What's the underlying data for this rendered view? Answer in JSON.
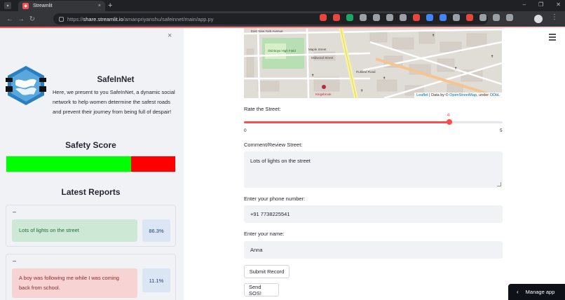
{
  "browser": {
    "tab_title": "Streamlit",
    "new_tab": "+",
    "tab_close": "×",
    "url_host": "share.streamlit.io",
    "url_path": "/amanpriyanshu/safeinnet/main/app.py",
    "url_scheme": "https://",
    "back": "←",
    "forward": "→",
    "reload": "↻",
    "window_controls": [
      "–",
      "❐",
      "✕"
    ],
    "menu_icon": "⋮",
    "extension_colors": [
      "#e8453c",
      "#e8453c",
      "#1fa463",
      "#9aa0a6",
      "#9aa0a6",
      "#9aa0a6",
      "#9aa0a6",
      "#e8453c",
      "#4285f4",
      "#4285f4",
      "#9aa0a6",
      "#e8453c",
      "#9aa0a6",
      "#9aa0a6",
      "#9aa0a6"
    ]
  },
  "sidebar": {
    "close": "×",
    "title": "SafeInNet",
    "description": "Here, we present to you SafeInNet, a dynamic social network to help women determine the safest roads and prevent their journey from being full of despair!",
    "score_title": "Safety Score",
    "score_good_fraction": 0.74,
    "score_good_color": "#00ff00",
    "score_bad_color": "#ff0000",
    "reports_title": "Latest Reports",
    "reports": [
      {
        "marker": "–",
        "text": "Lots of lights on the street",
        "percent": "86.3%",
        "tone": "green"
      },
      {
        "marker": "–",
        "text": "A boy was following me while I was coming back from school.",
        "percent": "11.1%",
        "tone": "red"
      }
    ]
  },
  "map": {
    "labels": {
      "street1": "East New York Avenue",
      "street2": "Maple Street",
      "street3": "Midwood Street",
      "street4": "Rutland Road",
      "park": "Old Boys High Field",
      "poi": "Kingsbrook"
    },
    "attribution_link": "Leaflet",
    "attribution_text": " | Data by © ",
    "attribution_osm": "OpenStreetMap",
    "attribution_under": ", under ",
    "attribution_license": "ODbL"
  },
  "form": {
    "rate_label": "Rate the Street:",
    "rate_value": 4,
    "rate_value_text": "4",
    "rate_min": 0,
    "rate_max": 5,
    "rate_min_text": "0",
    "rate_max_text": "5",
    "comment_label": "Comment/Review Street:",
    "comment_value": "Lots of lights on the street",
    "phone_label": "Enter your phone number:",
    "phone_value": "+91 7738225541",
    "name_label": "Enter your name:",
    "name_value": "Anna",
    "submit_label": "Submit Record",
    "sos_label": "Send SOS!"
  },
  "manage_app": {
    "label": "Manage app",
    "chevron": "‹"
  }
}
